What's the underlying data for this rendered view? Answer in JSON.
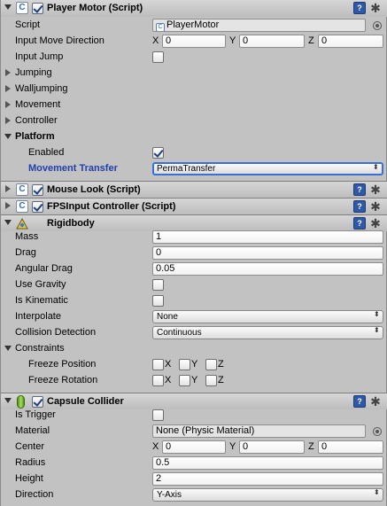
{
  "player_motor": {
    "title": "Player Motor (Script)",
    "script_label": "Script",
    "script_value": "PlayerMotor",
    "input_move_label": "Input Move Direction",
    "input_move": {
      "x_axis": "X",
      "x": "0",
      "y_axis": "Y",
      "y": "0",
      "z_axis": "Z",
      "z": "0"
    },
    "input_jump_label": "Input Jump",
    "foldouts": [
      "Jumping",
      "Walljumping",
      "Movement",
      "Controller"
    ],
    "platform_label": "Platform",
    "enabled_label": "Enabled",
    "movement_transfer_label": "Movement Transfer",
    "movement_transfer_value": "PermaTransfer"
  },
  "mouse_look": {
    "title": "Mouse Look (Script)"
  },
  "fps_input": {
    "title": "FPSInput Controller (Script)"
  },
  "rigidbody": {
    "title": "Rigidbody",
    "mass_label": "Mass",
    "mass": "1",
    "drag_label": "Drag",
    "drag": "0",
    "angular_drag_label": "Angular Drag",
    "angular_drag": "0.05",
    "use_gravity_label": "Use Gravity",
    "is_kinematic_label": "Is Kinematic",
    "interpolate_label": "Interpolate",
    "interpolate": "None",
    "collision_label": "Collision Detection",
    "collision": "Continuous",
    "constraints_label": "Constraints",
    "freeze_position_label": "Freeze Position",
    "freeze_rotation_label": "Freeze Rotation",
    "axis_x": "X",
    "axis_y": "Y",
    "axis_z": "Z"
  },
  "capsule": {
    "title": "Capsule Collider",
    "is_trigger_label": "Is Trigger",
    "material_label": "Material",
    "material": "None (Physic Material)",
    "center_label": "Center",
    "center": {
      "x_axis": "X",
      "x": "0",
      "y_axis": "Y",
      "y": "0",
      "z_axis": "Z",
      "z": "0"
    },
    "radius_label": "Radius",
    "radius": "0.5",
    "height_label": "Height",
    "height": "2",
    "direction_label": "Direction",
    "direction": "Y-Axis"
  },
  "icons": {
    "help": "?",
    "gear": "✱",
    "script": "C",
    "arrow": "⬍"
  },
  "colors": {
    "accent_label": "#1f3fae",
    "focus_border": "#3a6fd8",
    "help_blue": "#2f58a6"
  }
}
